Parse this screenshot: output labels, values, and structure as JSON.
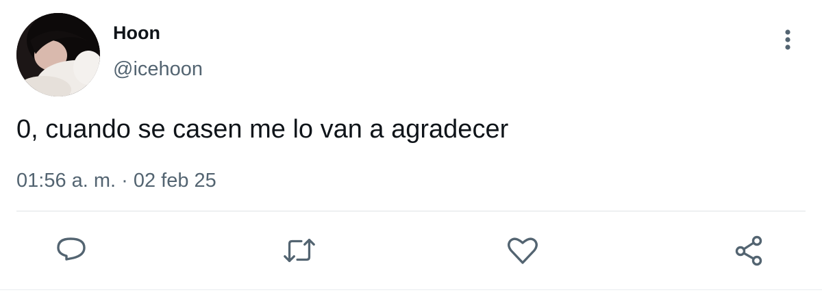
{
  "user": {
    "display_name": "Hoon",
    "handle": "@icehoon"
  },
  "tweet": {
    "text": "0, cuando se casen me lo van a agradecer",
    "timestamp": "01:56 a. m. · 02 feb 25"
  },
  "icons": {
    "more": "more-vertical-icon",
    "reply": "reply-icon",
    "retweet": "retweet-icon",
    "like": "heart-icon",
    "share": "share-icon"
  },
  "colors": {
    "text": "#0f1419",
    "secondary": "#536471",
    "icon": "#536471",
    "divider": "#dfe3e6"
  }
}
